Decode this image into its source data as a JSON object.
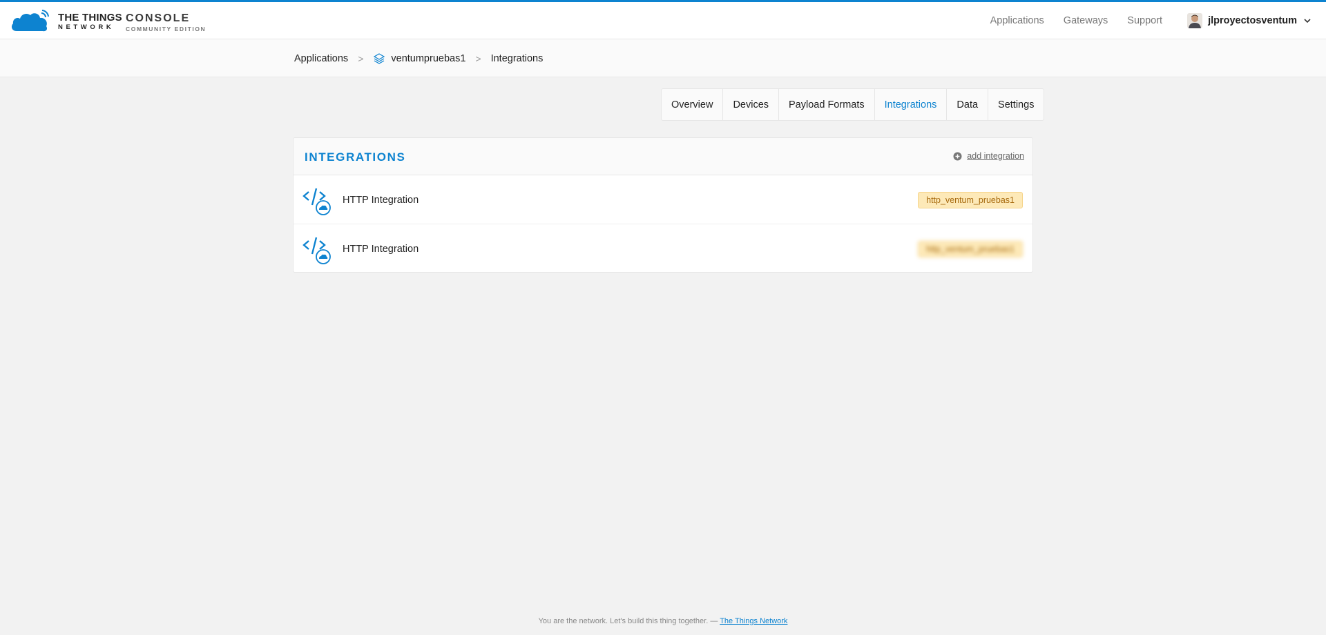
{
  "header": {
    "logo_main": "THE THINGS",
    "logo_sub": "NETWORK",
    "console_main": "CONSOLE",
    "console_sub": "COMMUNITY EDITION",
    "nav": [
      "Applications",
      "Gateways",
      "Support"
    ],
    "username": "jlproyectosventum"
  },
  "breadcrumb": {
    "items": [
      "Applications",
      "ventumpruebas1",
      "Integrations"
    ],
    "separator": ">"
  },
  "tabs": [
    {
      "label": "Overview"
    },
    {
      "label": "Devices"
    },
    {
      "label": "Payload Formats"
    },
    {
      "label": "Integrations",
      "active": true
    },
    {
      "label": "Data"
    },
    {
      "label": "Settings"
    }
  ],
  "panel": {
    "title": "INTEGRATIONS",
    "add_label": "add integration",
    "rows": [
      {
        "label": "HTTP Integration",
        "badge": "http_ventum_pruebas1"
      },
      {
        "label": "HTTP Integration",
        "badge": "http_ventum_pruebas1",
        "badge_blurred": true
      }
    ]
  },
  "footer": {
    "text": "You are the network. Let's build this thing together. — ",
    "link": "The Things Network"
  },
  "colors": {
    "accent": "#0d83d0",
    "badge_bg": "#fde9b8",
    "badge_text": "#a86b0f",
    "page_bg": "#f2f2f2"
  },
  "icons": {
    "logo": "ttn-cloud-icon",
    "application": "layers-icon",
    "add": "plus-circle-icon",
    "integration": "http-integration-icon",
    "user_menu": "chevron-down-icon"
  }
}
